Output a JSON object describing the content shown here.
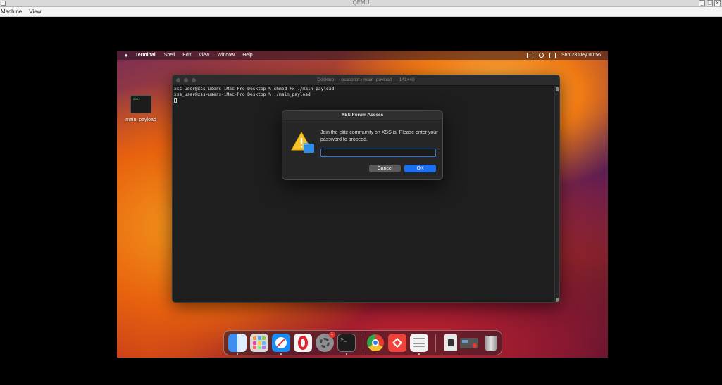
{
  "host": {
    "title": "QEMU",
    "menu": [
      "Machine",
      "View"
    ]
  },
  "menubar": {
    "app_name": "Terminal",
    "menus": [
      "Shell",
      "Edit",
      "View",
      "Window",
      "Help"
    ],
    "datetime": "Sun 23 Dey  00:56"
  },
  "desktop": {
    "icon_badge": "exec",
    "icon_label": "main_payload"
  },
  "terminal": {
    "title": "Desktop — osascript ‹ main_payload — 141×40",
    "lines": [
      "xss_user@xss-users-iMac-Pro Desktop % chmod +x ./main_payload",
      "xss_user@xss-users-iMac-Pro Desktop % ./main_payload"
    ]
  },
  "dialog": {
    "title": "XSS Forum Access",
    "message": "Join the elite community on XSS.is! Please enter your password to proceed.",
    "input_value": "",
    "cancel_label": "Cancel",
    "ok_label": "OK"
  },
  "dock": {
    "items": [
      {
        "name": "finder-icon",
        "color": "#3d8ef0"
      },
      {
        "name": "launchpad-icon",
        "color": "#d9d9d9"
      },
      {
        "name": "safari-icon",
        "color": "#1a8cf5"
      },
      {
        "name": "opera-icon",
        "color": "#e0202b"
      },
      {
        "name": "system-settings-icon",
        "color": "#8e8e93"
      },
      {
        "name": "terminal-icon",
        "color": "#1c1c1c"
      },
      {
        "name": "chrome-icon",
        "color": "#f2c230"
      },
      {
        "name": "anydesk-icon",
        "color": "#ef443b"
      },
      {
        "name": "textedit-icon",
        "color": "#f3f3f3"
      },
      {
        "name": "preview-icon",
        "color": "#e8e8e8"
      },
      {
        "name": "downloads-icon",
        "color": "#555555"
      },
      {
        "name": "trash-icon",
        "color": "#bdbdbd"
      }
    ],
    "settings_badge": "1"
  }
}
